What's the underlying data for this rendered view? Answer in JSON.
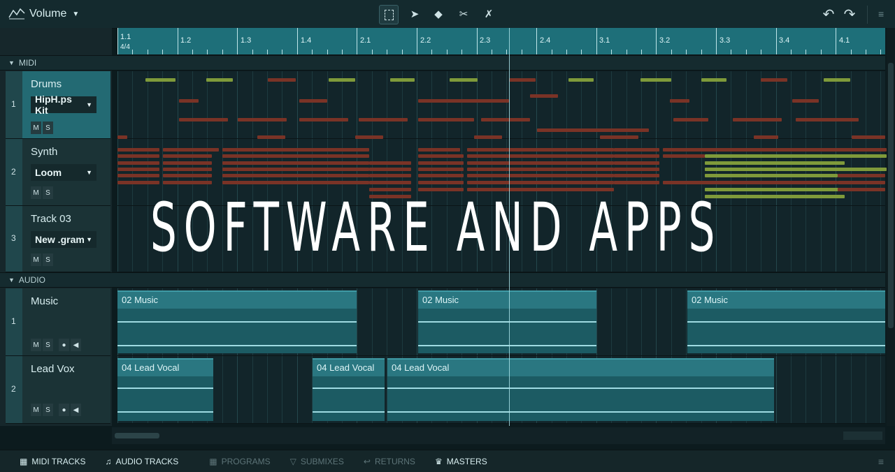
{
  "toolbar": {
    "automation_param": "Volume",
    "tools": [
      "select-tool",
      "pointer-tool",
      "eraser-tool",
      "cut-tool",
      "mute-tool"
    ],
    "undo": "undo-icon",
    "redo": "redo-icon"
  },
  "ruler": {
    "labels": [
      "1.1",
      "1.2",
      "1.3",
      "1.4",
      "2.1",
      "2.2",
      "2.3",
      "2.4",
      "3.1",
      "3.2",
      "3.3",
      "3.4",
      "4.1"
    ],
    "time_signature": "4/4"
  },
  "sections": {
    "midi": "MIDI",
    "audio": "AUDIO"
  },
  "midi_tracks": [
    {
      "number": "1",
      "name": "Drums",
      "program": "HipH.ps Kit"
    },
    {
      "number": "2",
      "name": "Synth",
      "program": "Loom"
    },
    {
      "number": "3",
      "name": "Track 03",
      "program": "New .gram"
    }
  ],
  "audio_tracks": [
    {
      "number": "1",
      "name": "Music",
      "clips": [
        "02 Music",
        "02 Music",
        "02 Music"
      ]
    },
    {
      "number": "2",
      "name": "Lead Vox",
      "clips": [
        "04 Lead Vocal",
        "04 Lead Vocal",
        "04 Lead Vocal"
      ]
    }
  ],
  "button_labels": {
    "mute": "M",
    "solo": "S"
  },
  "overlay_title": "SOFTWARE AND APPS",
  "bottom_tabs": [
    {
      "label": "MIDI TRACKS",
      "active": true
    },
    {
      "label": "AUDIO TRACKS",
      "active": true
    },
    {
      "label": "PROGRAMS",
      "active": false
    },
    {
      "label": "SUBMIXES",
      "active": false
    },
    {
      "label": "RETURNS",
      "active": false
    },
    {
      "label": "MASTERS",
      "active": true
    }
  ],
  "colors": {
    "ruler": "#1e6f79",
    "selected_track": "#236a73",
    "note_red": "#7a3326",
    "note_green": "#7f9a3a",
    "clip": "#1c5b63"
  }
}
